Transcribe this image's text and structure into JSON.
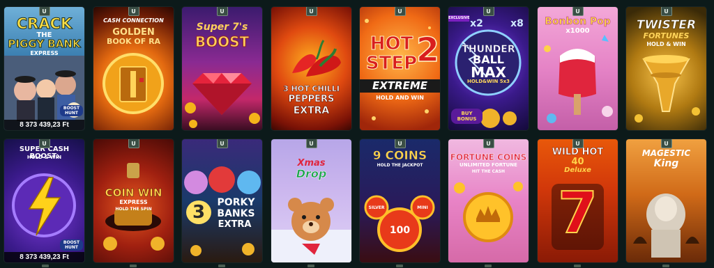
{
  "provider_badge": "U",
  "jackpot_amount": "8 373 439,23 Ft",
  "row1": [
    {
      "line1": "CRACK",
      "line2": "THE",
      "line3": "PIGGY BANK",
      "line4": "EXPRESS",
      "extra": "BOOST HUNT"
    },
    {
      "line1": "CASH CONNECTION",
      "line2": "GOLDEN",
      "line3": "BOOK OF RA"
    },
    {
      "line1": "Super 7's",
      "line2": "BOOST"
    },
    {
      "line1": "3 HOT CHILLI",
      "line2": "PEPPERS",
      "line3": "EXTRA"
    },
    {
      "line1": "HOT",
      "line2": "STEP",
      "num": "2",
      "line3": "EXTREME",
      "line4": "HOLD AND WIN"
    },
    {
      "line1": "THUNDER",
      "line2": "BALL",
      "line3": "MAX",
      "line4": "HOLD&WIN 5x3",
      "tag": "EXCLUSIVE",
      "mult1": "x2",
      "mult2": "x8",
      "buy": "BUY BONUS"
    },
    {
      "line1": "Bonbon Pop",
      "line2": "x1000"
    },
    {
      "line1": "TWISTER",
      "line2": "FORTUNES",
      "line3": "HOLD & WIN"
    }
  ],
  "row2": [
    {
      "line1": "SUPER CASH BOOST:",
      "line2": "HOLD & WIN",
      "extra": "BOOST HUNT"
    },
    {
      "line1": "COIN WIN",
      "line2": "EXPRESS",
      "line3": "HOLD THE SPIN"
    },
    {
      "line1": "3",
      "line2": "PORKY",
      "line3": "BANKS",
      "line4": "EXTRA"
    },
    {
      "line1": "Xmas",
      "line2": "Drop"
    },
    {
      "line1": "9 COINS",
      "line2": "HOLD THE JACKPOT",
      "coin1": "SILVER",
      "coin2": "MINI",
      "coin3": "100"
    },
    {
      "line1": "FORTUNE COINS",
      "line2": "UNLIMITED FORTUNE",
      "line3": "HIT THE CASH"
    },
    {
      "line1": "WILD HOT",
      "line2": "40",
      "line3": "Deluxe",
      "seven": "7"
    },
    {
      "line1": "MAGESTIC",
      "line2": "King"
    }
  ]
}
